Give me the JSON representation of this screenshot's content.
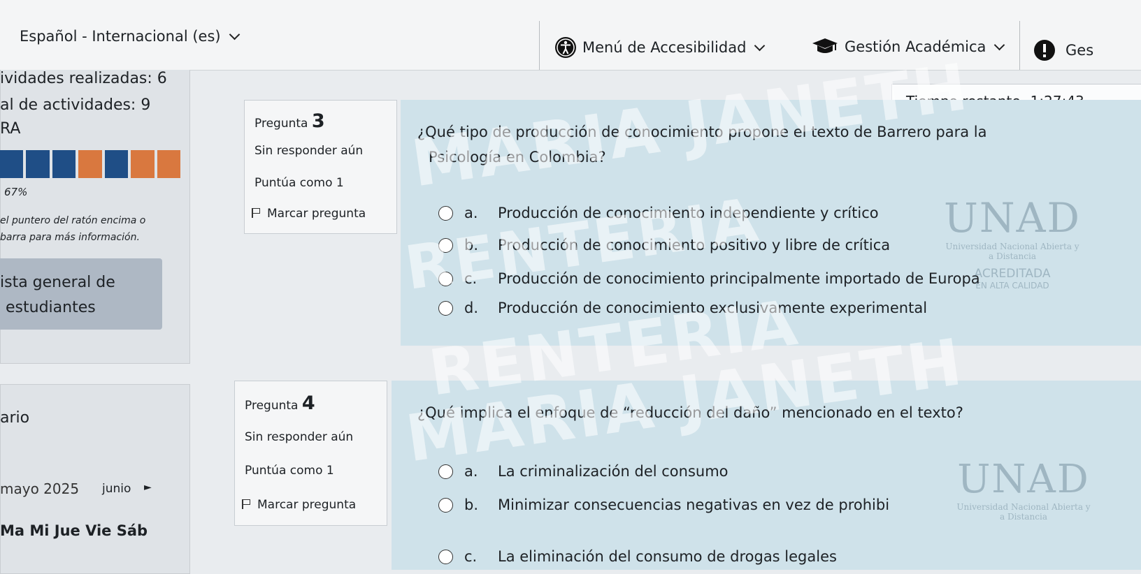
{
  "topbar": {
    "language": "Español - Internacional (es)",
    "accessibility": "Menú de Accesibilidad",
    "academic": "Gestión Académica",
    "gest": "Ges"
  },
  "sidebar": {
    "activities_done": "ividades realizadas: 6",
    "activities_total": "al de actividades: 9",
    "header": "RA",
    "progress_percent": "67%",
    "progress_fraction": 0.67,
    "hint_line1": "el puntero del ratón encima o",
    "hint_line2": "barra para más información.",
    "report_line1": "ista general de",
    "report_line2": "estudiantes",
    "calendar_title": "ario",
    "calendar_month": "mayo 2025",
    "calendar_next": "junio",
    "weekdays": "Ma  Mi  Jue  Vie  Sáb"
  },
  "timer": {
    "label": "Tiempo restante",
    "value": "1:27:43"
  },
  "questions": [
    {
      "label": "Pregunta",
      "number": "3",
      "status": "Sin responder aún",
      "score": "Puntúa como 1",
      "flag": "Marcar pregunta",
      "text_line1": "¿Qué tipo de producción de conocimiento propone el texto de Barrero para la",
      "text_line2": "Psicología en Colombia?",
      "answers": [
        {
          "letter": "a.",
          "text": "Producción de conocimiento independiente y crítico"
        },
        {
          "letter": "b.",
          "text": "Producción de conocimiento positivo y libre de crítica"
        },
        {
          "letter": "c.",
          "text": "Producción de conocimiento principalmente importado de Europa"
        },
        {
          "letter": "d.",
          "text": "Producción de conocimiento exclusivamente experimental"
        }
      ]
    },
    {
      "label": "Pregunta",
      "number": "4",
      "status": "Sin responder aún",
      "score": "Puntúa como 1",
      "flag": "Marcar pregunta",
      "text_line1": "¿Qué implica el enfoque de “reducción del daño” mencionado en el texto?",
      "answers": [
        {
          "letter": "a.",
          "text": "La criminalización del consumo"
        },
        {
          "letter": "b.",
          "text": "Minimizar consecuencias negativas en vez de prohibi"
        },
        {
          "letter": "c.",
          "text": "La eliminación del consumo de drogas legales"
        }
      ]
    }
  ],
  "watermark": {
    "line1": "MARIA JANETH",
    "line2": "RENTERIA"
  },
  "logo": {
    "name": "UNAD",
    "subtitle": "Universidad Nacional Abierta y a Distancia",
    "accreditation1": "ACREDITADA",
    "accreditation2": "EN ALTA CALIDAD"
  },
  "colors": {
    "progress_blue": "#1f4e86",
    "progress_orange": "#d9783f",
    "question_bg": "#cfe2ea",
    "info_bg": "#f5f6f7"
  },
  "icons": [
    "accessibility-icon",
    "graduation-cap-icon",
    "alert-icon",
    "chevron-down-icon",
    "flag-icon",
    "radio-icon"
  ]
}
